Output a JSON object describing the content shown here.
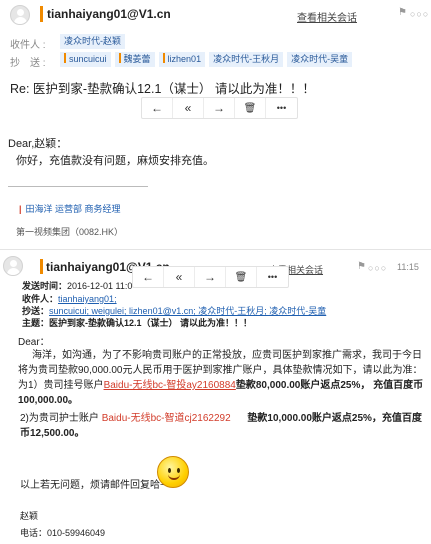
{
  "email1": {
    "sender": "tianhaiyang01@V1.cn",
    "view_conversation": "查看相关会话",
    "flag_icon": "⚑",
    "dots_icon": "○○○",
    "to_label": "收件人 :",
    "to": [
      "凌众时代-赵颖"
    ],
    "cc_label": "抄　送 :",
    "cc": [
      "suncuicui",
      "魏姜蕾",
      "lizhen01",
      "凌众时代-王秋月",
      "凌众时代-吴童"
    ],
    "subject": "Re: 医护到家-垫款确认12.1（谋士） 请以此为准！！！",
    "toolbar": {
      "reply": "←",
      "reply_all": "«",
      "forward": "→",
      "delete": "🗑",
      "more": "•••"
    },
    "greeting": "Dear,赵颖：",
    "body": "你好，充值款没有问题，麻烦安排充值。",
    "sig_name_line": "田海洋  运营部  商务经理",
    "sig_company": "第一视频集团（0082.HK）"
  },
  "email2": {
    "sender": "tianhaiyang01@V1.cn",
    "view_conversation": "查看相关会话",
    "flag_icon": "⚑",
    "dots_icon": "○○○",
    "time": "11:15",
    "toolbar": {
      "reply": "←",
      "reply_all": "«",
      "forward": "→",
      "delete": "🗑",
      "more": "•••"
    },
    "quote": {
      "sent_label": "发送时间：",
      "sent": "2016-12-01 11:0",
      "to_label": "收件人：",
      "to": "tianhaiyang01;",
      "cc_label": "抄送：",
      "cc": "suncuicui; weigulei; lizhen01@v1.cn; 凌众时代-王秋月; 凌众时代-吴童",
      "subject_label": "主题：",
      "subject": "医护到家-垫款确认12.1（谋士） 请以此为准！！！"
    },
    "dear": "Dear：",
    "para1": "海洋，如沟通，为了不影响贵司账户的正常投放，应贵司医护到家推广需求，我司于今日将为贵司垫款90,000.00元人民币用于医护到家推广账户，具体垫款情况如下，请以此为准：",
    "item1_pre": "为1）贵司挂号账户",
    "item1_account": "Baidu-无线bc-智投ay2160884",
    "item1_amount": "垫款80,000.00账户返点25%，  充值百度币100,000.00。",
    "item2_pre": "2)为贵司护士账户",
    "item2_account": "Baidu-无线bc-智道cj2162292",
    "item2_amount": "垫款10,000.00账户返点25%，充值百度币12,500.00。",
    "closing": "以上若无问题，烦请邮件回复哈~",
    "sig_name": "赵颖",
    "sig_phone": "电话：010-59946049"
  }
}
